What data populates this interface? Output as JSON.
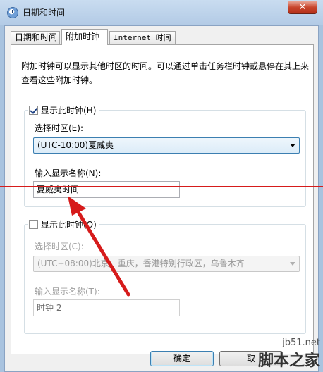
{
  "window": {
    "title": "日期和时间",
    "close_glyph": "✕"
  },
  "tabs": [
    {
      "label": "日期和时间"
    },
    {
      "label": "附加时钟"
    },
    {
      "label": "Internet 时间"
    }
  ],
  "description": "附加时钟可以显示其他时区的时间。可以通过单击任务栏时钟或悬停在其上来查看这些附加时钟。",
  "clock1": {
    "show_label": "显示此时钟(H)",
    "checked": true,
    "timezone_label": "选择时区(E):",
    "timezone_value": "(UTC-10:00)夏威夷",
    "name_label": "输入显示名称(N):",
    "name_value": "夏威夷时间"
  },
  "clock2": {
    "show_label": "显示此时钟(O)",
    "checked": false,
    "timezone_label": "选择时区(C):",
    "timezone_value": "(UTC+08:00)北京，重庆，香港特别行政区，乌鲁木齐",
    "name_label": "输入显示名称(T):",
    "name_value": "时钟 2"
  },
  "buttons": {
    "ok": "确定",
    "cancel": "取"
  },
  "watermark": {
    "site": "jb51.net",
    "name": "脚本之家"
  },
  "colors": {
    "annotation": "#d61b1b",
    "titlebar": "#b3cbe6",
    "close": "#c8452c"
  }
}
